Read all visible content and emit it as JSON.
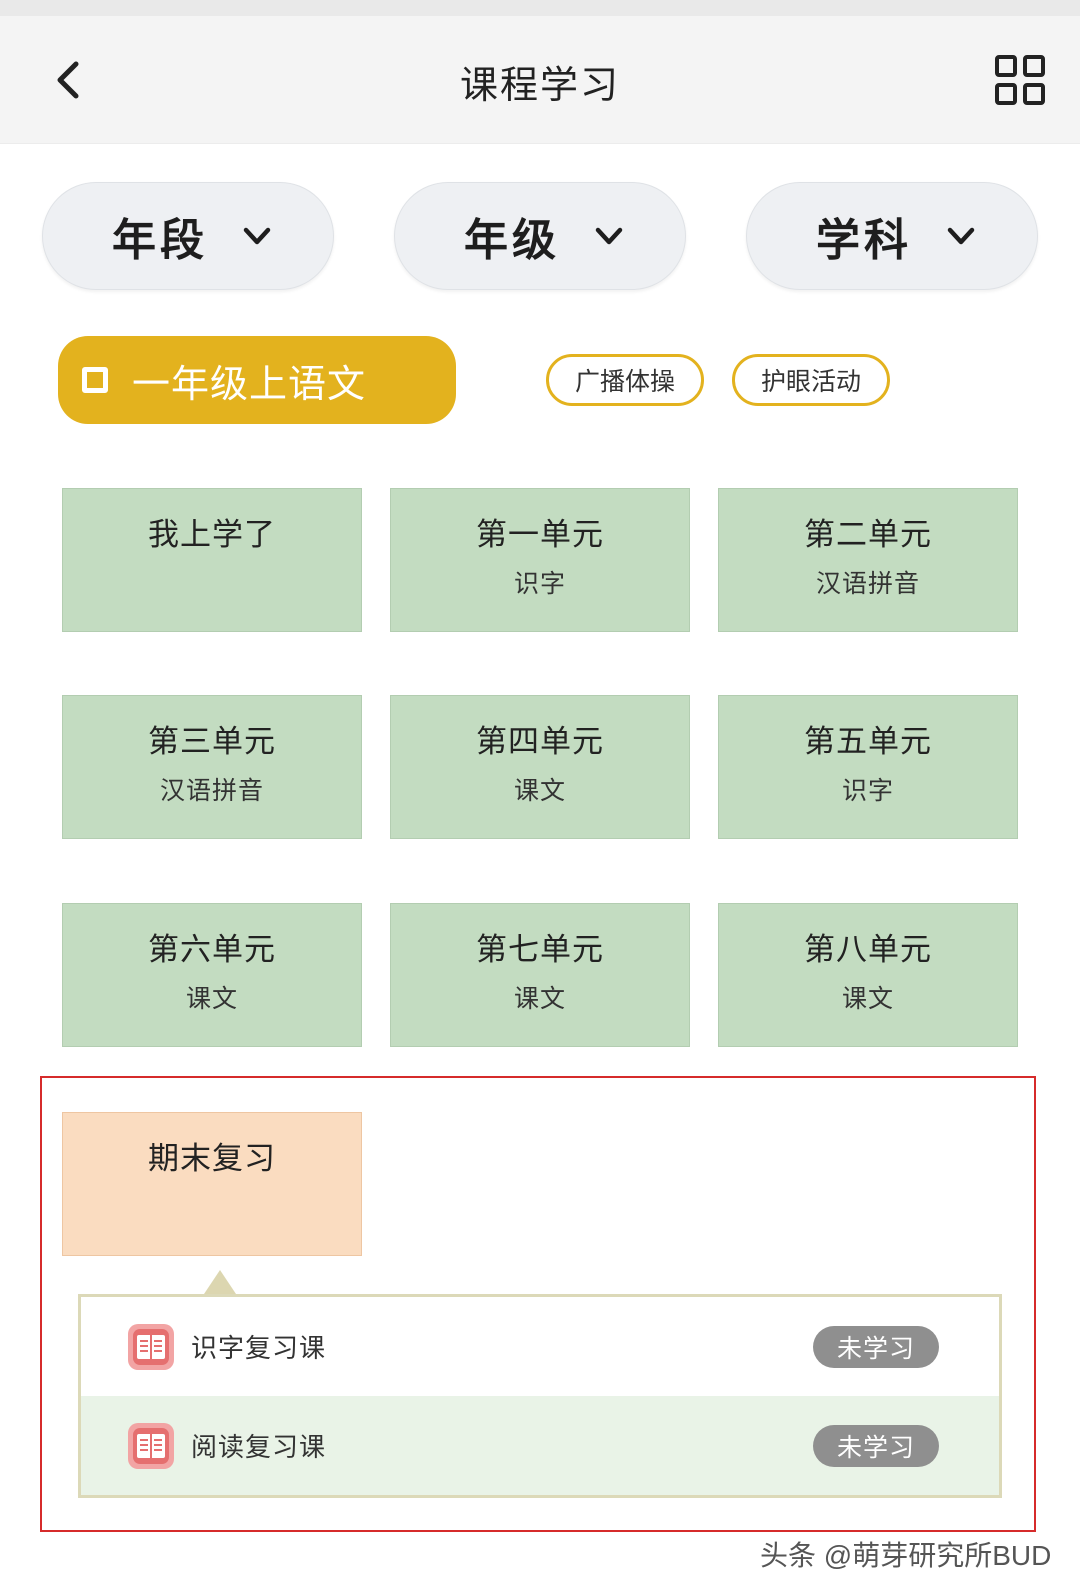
{
  "header": {
    "title": "课程学习",
    "back_icon": "chevron-left-icon",
    "menu_icon": "grid-icon"
  },
  "filters": [
    {
      "label": "年段"
    },
    {
      "label": "年级"
    },
    {
      "label": "学科"
    }
  ],
  "course": {
    "label": "一年级上语文",
    "accent_color": "#e3b21e"
  },
  "tags": [
    "广播体操",
    "护眼活动"
  ],
  "units": [
    {
      "title": "我上学了",
      "sub": ""
    },
    {
      "title": "第一单元",
      "sub": "识字"
    },
    {
      "title": "第二单元",
      "sub": "汉语拼音"
    },
    {
      "title": "第三单元",
      "sub": "汉语拼音"
    },
    {
      "title": "第四单元",
      "sub": "课文"
    },
    {
      "title": "第五单元",
      "sub": "识字"
    },
    {
      "title": "第六单元",
      "sub": "课文"
    },
    {
      "title": "第七单元",
      "sub": "课文"
    },
    {
      "title": "第八单元",
      "sub": "课文"
    }
  ],
  "review": {
    "title": "期末复习",
    "lessons": [
      {
        "name": "识字复习课",
        "status": "未学习",
        "icon": "book-icon"
      },
      {
        "name": "阅读复习课",
        "status": "未学习",
        "icon": "book-icon"
      }
    ]
  },
  "watermark": "头条 @萌芽研究所BUD",
  "colors": {
    "unit_bg": "#c3dcc1",
    "review_bg": "#fadcc0",
    "highlight_border": "#d62b2b",
    "status_badge": "#8f8f8f"
  }
}
